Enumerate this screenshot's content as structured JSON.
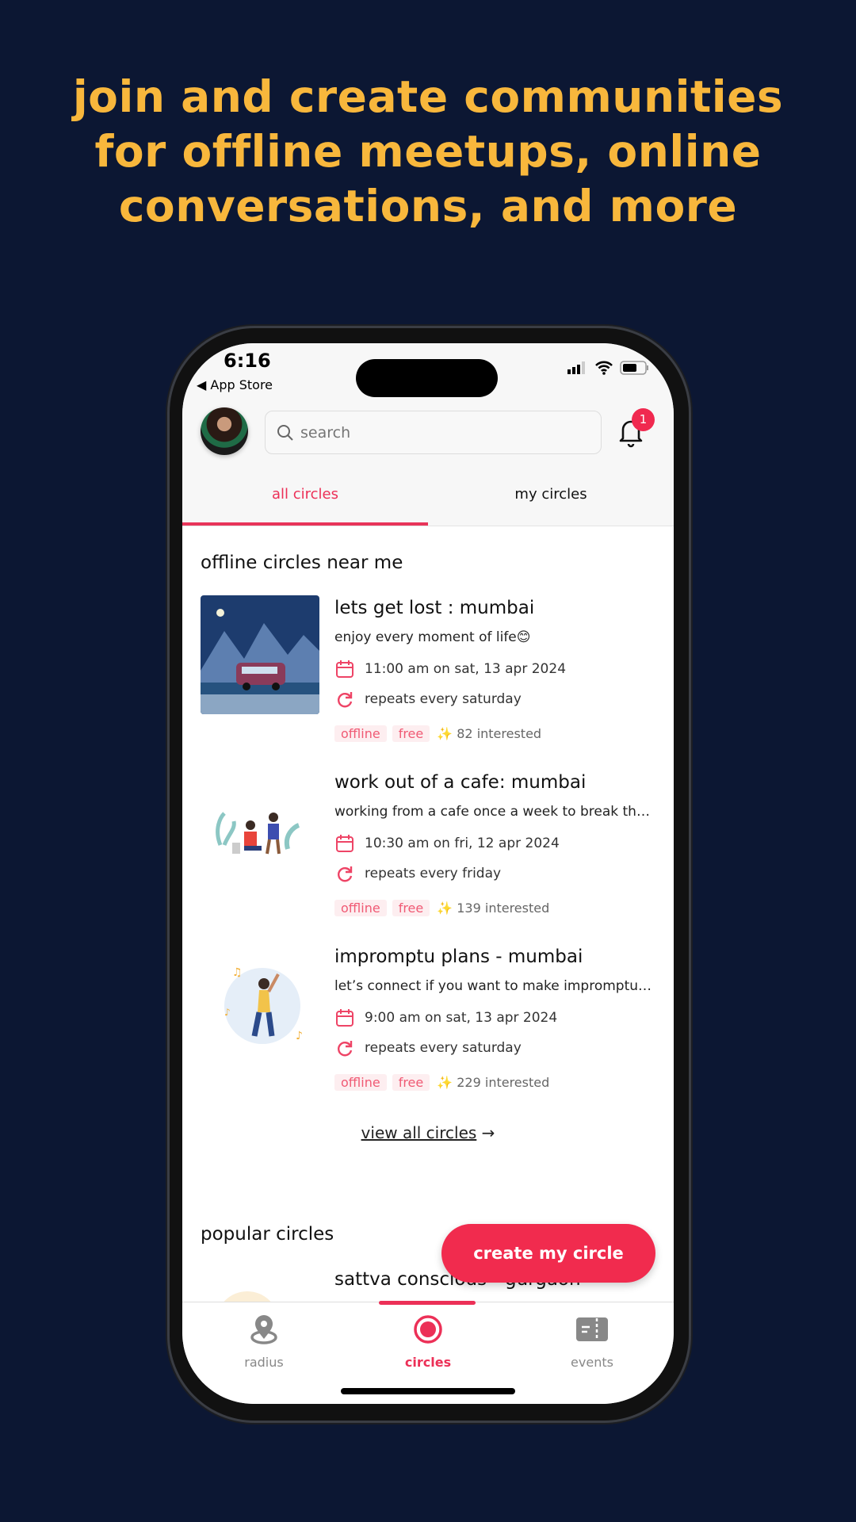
{
  "headline": [
    "join and create communities",
    "for offline meetups, online",
    "conversations, and more"
  ],
  "status": {
    "time": "6:16",
    "back_app": "◀ App Store"
  },
  "header": {
    "search_placeholder": "search",
    "notification_count": "1"
  },
  "tabs": [
    {
      "label": "all circles",
      "active": true
    },
    {
      "label": "my circles",
      "active": false
    }
  ],
  "sections": {
    "offline": "offline circles near me",
    "popular": "popular circles"
  },
  "circles": [
    {
      "title": "lets get lost : mumbai",
      "desc": "enjoy every moment of life😊",
      "date": "11:00 am on sat, 13 apr 2024",
      "repeat": "repeats every saturday",
      "tags": [
        "offline",
        "free"
      ],
      "interested": "✨ 82 interested"
    },
    {
      "title": "work out of a cafe: mumbai",
      "desc": "working from a cafe once a week to break the monotony",
      "date": "10:30 am on fri, 12 apr 2024",
      "repeat": "repeats every friday",
      "tags": [
        "offline",
        "free"
      ],
      "interested": "✨ 139 interested"
    },
    {
      "title": "impromptu plans - mumbai",
      "desc": "let’s connect if you want to make impromptu plans",
      "date": "9:00 am on sat, 13 apr 2024",
      "repeat": "repeats every saturday",
      "tags": [
        "offline",
        "free"
      ],
      "interested": "✨ 229 interested"
    }
  ],
  "view_all": "view all circles",
  "popular_first": "sattva conscious - gurgaon",
  "fab": "create my circle",
  "nav": [
    {
      "label": "radius",
      "icon": "location-radius-icon"
    },
    {
      "label": "circles",
      "icon": "circle-target-icon",
      "active": true
    },
    {
      "label": "events",
      "icon": "ticket-icon"
    }
  ],
  "colors": {
    "accent": "#f12b4e",
    "headline": "#f8b73c",
    "background": "#0c1733"
  }
}
